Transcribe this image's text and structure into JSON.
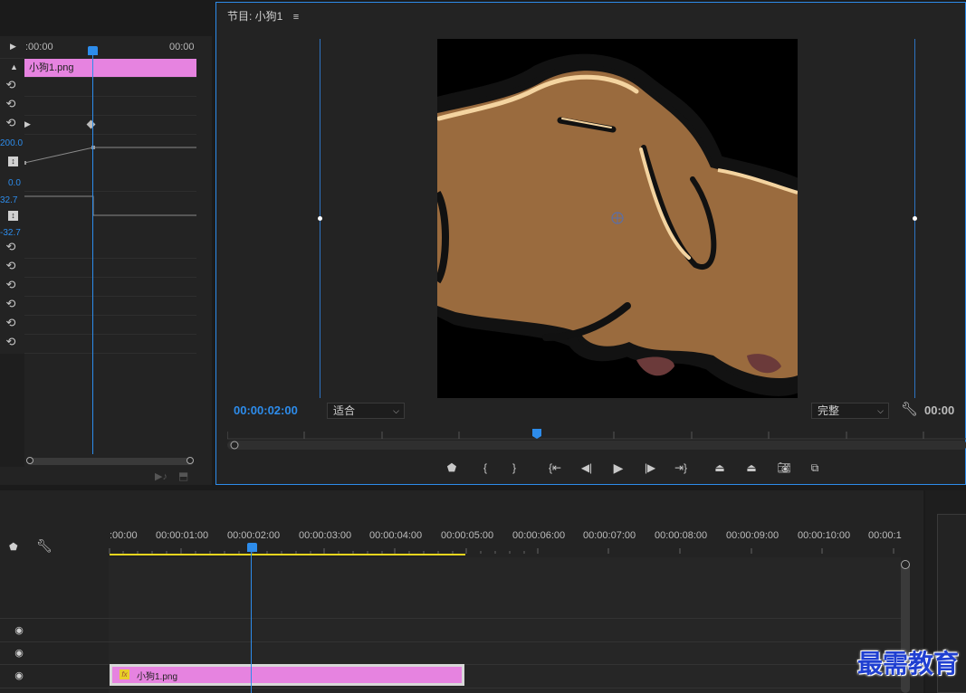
{
  "effect_controls": {
    "ruler_start": ":00:00",
    "ruler_end": "00:00",
    "clip_label": "小狗1.png",
    "value_top": "200.0",
    "value_zero": "0.0",
    "value_pos": "32.7",
    "value_neg": "-32.7"
  },
  "program_monitor": {
    "title": "节目: 小狗1",
    "menu_icon": "≡",
    "timecode": "00:00:02:00",
    "zoom_select": "适合",
    "quality_select": "完整",
    "timecode_right": "00:00"
  },
  "timeline": {
    "ruler_labels": [
      ":00:00",
      "00:00:01:00",
      "00:00:02:00",
      "00:00:03:00",
      "00:00:04:00",
      "00:00:05:00",
      "00:00:06:00",
      "00:00:07:00",
      "00:00:08:00",
      "00:00:09:00",
      "00:00:10:00",
      "00:00:1"
    ],
    "clip_label": "小狗1.png",
    "fx_badge": "fx"
  },
  "watermark": "最需教育",
  "colors": {
    "accent": "#2d8ceb",
    "clip": "#e683e0",
    "work_area": "#e6d51e",
    "dog": "#9a6b3e"
  }
}
